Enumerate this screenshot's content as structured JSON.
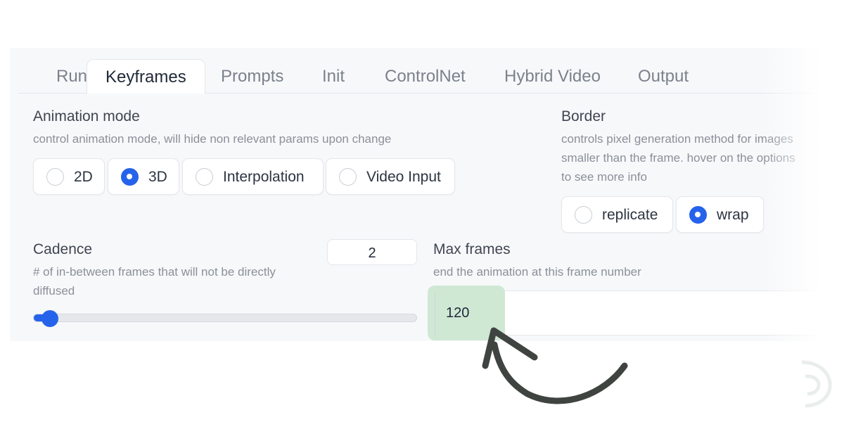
{
  "tabs": [
    "Run",
    "Keyframes",
    "Prompts",
    "Init",
    "ControlNet",
    "Hybrid Video",
    "Output"
  ],
  "active_tab": "Keyframes",
  "animation_mode": {
    "label": "Animation mode",
    "info": "control animation mode, will hide non relevant params upon change",
    "options": [
      "2D",
      "3D",
      "Interpolation",
      "Video Input"
    ],
    "selected": "3D"
  },
  "border": {
    "label": "Border",
    "info_lines": [
      "controls pixel generation method for images",
      "smaller than the frame. hover on the options",
      "to see more info"
    ],
    "options": [
      "replicate",
      "wrap"
    ],
    "selected": "wrap"
  },
  "cadence": {
    "label": "Cadence",
    "info_lines": [
      "# of in-between frames that will not be directly",
      "diffused"
    ],
    "value": "2",
    "slider_fraction": 0.04
  },
  "max_frames": {
    "label": "Max frames",
    "info": "end the animation at this frame number",
    "value": "120"
  },
  "colors": {
    "accent": "#2563eb",
    "highlight": "#cfe8d4",
    "arrow": "#3f4441"
  }
}
